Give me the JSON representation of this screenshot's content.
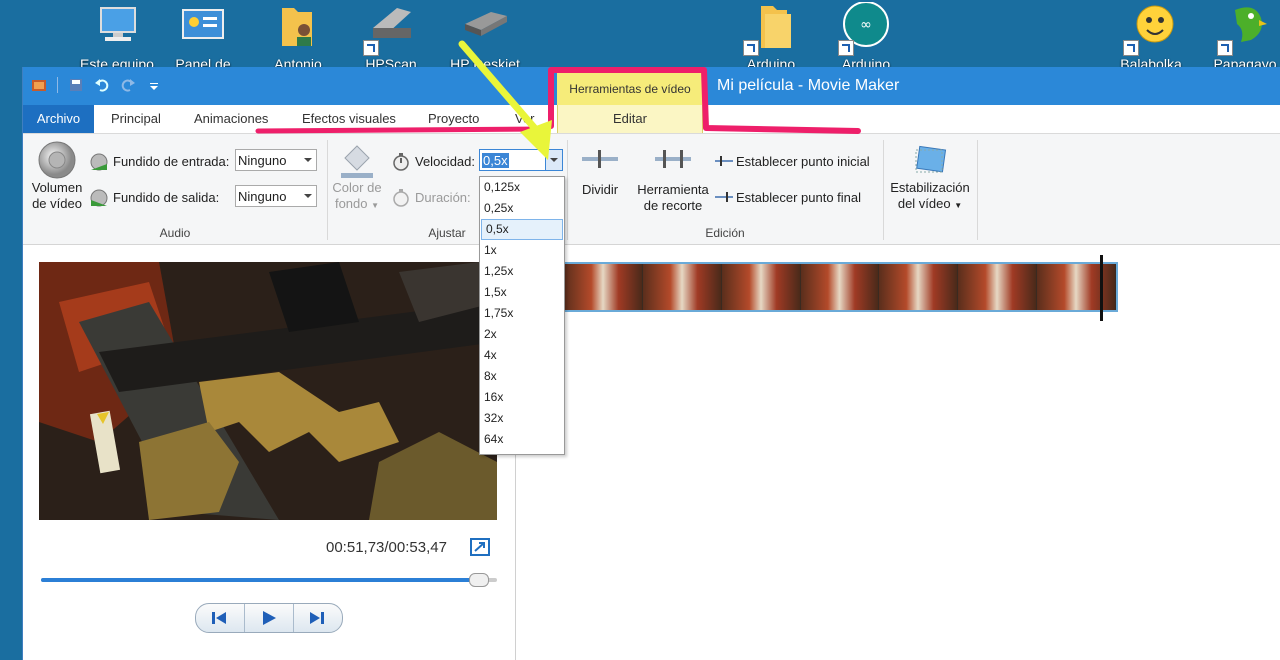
{
  "desktop": {
    "icons": [
      {
        "name": "pc-icon",
        "label": "Este equipo"
      },
      {
        "name": "control-panel-icon",
        "label": "Panel de"
      },
      {
        "name": "user-folder-icon",
        "label": "Antonio"
      },
      {
        "name": "scanner-icon",
        "label": "HPScan"
      },
      {
        "name": "printer-icon",
        "label": "HP Deskjet"
      },
      {
        "name": "folder-icon",
        "label": "Arduino"
      },
      {
        "name": "arduino-icon",
        "label": "Arduino"
      },
      {
        "name": "balabolka-icon",
        "label": "Balabolka"
      },
      {
        "name": "papagayo-icon",
        "label": "Papagayo"
      }
    ]
  },
  "window": {
    "context_tab_group": "Herramientas de vídeo",
    "title": "Mi película - Movie Maker",
    "tabs": [
      "Archivo",
      "Principal",
      "Animaciones",
      "Efectos visuales",
      "Proyecto",
      "Ver",
      "Editar"
    ],
    "active_tab": "Editar"
  },
  "ribbon": {
    "audio": {
      "volume_label_1": "Volumen",
      "volume_label_2": "de vídeo",
      "fade_in_label": "Fundido de entrada:",
      "fade_in_value": "Ninguno",
      "fade_out_label": "Fundido de salida:",
      "fade_out_value": "Ninguno",
      "group_label": "Audio"
    },
    "adjust": {
      "bg_color_label_1": "Color de",
      "bg_color_label_2": "fondo",
      "speed_label": "Velocidad:",
      "speed_value": "0,5x",
      "duration_label": "Duración:",
      "group_label": "Ajustar"
    },
    "edit": {
      "split_label": "Dividir",
      "trim_label_1": "Herramienta",
      "trim_label_2": "de recorte",
      "set_start_label": "Establecer punto inicial",
      "set_end_label": "Establecer punto final",
      "group_label": "Edición"
    },
    "stabilize": {
      "label_1": "Estabilización",
      "label_2": "del vídeo"
    }
  },
  "speed_options": [
    "0,125x",
    "0,25x",
    "0,5x",
    "1x",
    "1,25x",
    "1,5x",
    "1,75x",
    "2x",
    "4x",
    "8x",
    "16x",
    "32x",
    "64x"
  ],
  "speed_selected": "0,5x",
  "preview": {
    "timecode": "00:51,73/00:53,47",
    "progress": 0.97
  },
  "colors": {
    "accent": "#2b88d8",
    "context_tab": "#f6ec7a",
    "annotation_red": "#ee1f6a",
    "annotation_yellow": "#e9f53a"
  }
}
